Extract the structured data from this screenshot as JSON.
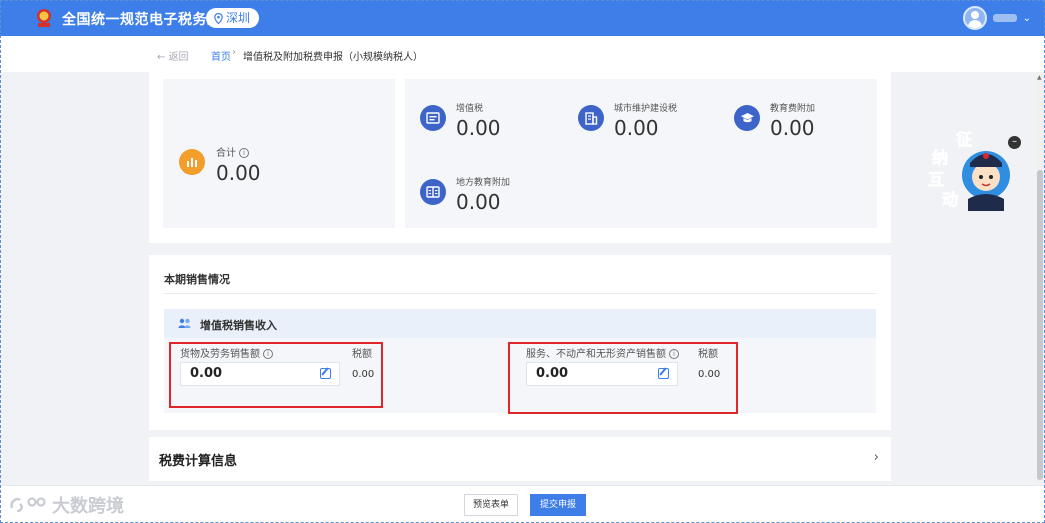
{
  "header": {
    "site_title": "全国统一规范电子税务局",
    "city": "深圳"
  },
  "breadcrumb": {
    "back": "返回",
    "home": "首页",
    "separator": "›",
    "current": "增值税及附加税费申报（小规模纳税人）"
  },
  "summary": {
    "total": {
      "label": "合计",
      "value": "0.00",
      "icon": "bar-chart-icon"
    },
    "taxes": [
      {
        "label": "增值税",
        "value": "0.00",
        "icon": "tax-document-icon"
      },
      {
        "label": "城市维护建设税",
        "value": "0.00",
        "icon": "building-icon"
      },
      {
        "label": "教育费附加",
        "value": "0.00",
        "icon": "graduation-cap-icon"
      },
      {
        "label": "地方教育附加",
        "value": "0.00",
        "icon": "book-icon"
      }
    ]
  },
  "sales": {
    "title": "本期销售情况",
    "vat_section_title": "增值税销售收入",
    "goods": {
      "label": "货物及劳务销售额",
      "value": "0.00",
      "tax_label": "税额",
      "tax_value": "0.00"
    },
    "services": {
      "label": "服务、不动产和无形资产销售额",
      "value": "0.00",
      "tax_label": "税额",
      "tax_value": "0.00"
    }
  },
  "calc_section": {
    "title": "税费计算信息",
    "chevron": "›"
  },
  "mascot": {
    "text_1": "征",
    "text_2": "纳",
    "text_3": "互",
    "text_4": "动"
  },
  "footer": {
    "preview_label": "预览表单",
    "submit_label": "提交申报",
    "watermark": "大数跨境"
  },
  "colors": {
    "primary": "#3d7ee8",
    "highlight": "#e0262a",
    "total_icon": "#f19f2a",
    "tax_icon": "#3d64c9"
  }
}
